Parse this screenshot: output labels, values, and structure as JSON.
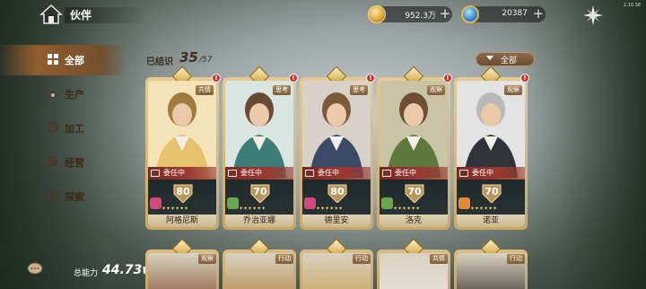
{
  "header": {
    "title": "伙伴",
    "gold_value": "952.3万",
    "gem_value": "20387",
    "plus": "+",
    "version": "2.10.38"
  },
  "sidebar": {
    "items": [
      {
        "label": "全部",
        "icon": "grid-icon",
        "active": true
      },
      {
        "label": "生产",
        "icon": "production-icon",
        "active": false
      },
      {
        "label": "加工",
        "icon": "processing-icon",
        "active": false
      },
      {
        "label": "经营",
        "icon": "business-icon",
        "active": false
      },
      {
        "label": "探索",
        "icon": "explore-icon",
        "active": false
      }
    ]
  },
  "summary": {
    "known_label": "已结识",
    "known_count": "35",
    "known_total": "/57",
    "filter_label": "全部",
    "power_label": "总能力",
    "power_value": "44.73w"
  },
  "cards": [
    {
      "name": "阿格尼斯",
      "tag": "共情",
      "level": "80",
      "status": "委任中",
      "skill_color": "#d24a7a"
    },
    {
      "name": "乔治亚娜",
      "tag": "思考",
      "level": "70",
      "status": "委任中",
      "skill_color": "#6aa84f"
    },
    {
      "name": "德里安",
      "tag": "思考",
      "level": "80",
      "status": "委任中",
      "skill_color": "#d24a7a"
    },
    {
      "name": "洛克",
      "tag": "观察",
      "level": "70",
      "status": "委任中",
      "skill_color": "#6aa84f"
    },
    {
      "name": "诺亚",
      "tag": "观察",
      "level": "70",
      "status": "委任中",
      "skill_color": "#e08a3a"
    }
  ],
  "cards_bottom": [
    {
      "tag": "观察"
    },
    {
      "tag": "行动"
    },
    {
      "tag": "行动"
    },
    {
      "tag": "共情"
    },
    {
      "tag": "行动"
    }
  ],
  "stars": "✦✦✦✦✦✦",
  "colors": {
    "accent_gold": "#d9a03a",
    "status_red": "#9b3a33",
    "sidebar_active": "#965f2d"
  }
}
